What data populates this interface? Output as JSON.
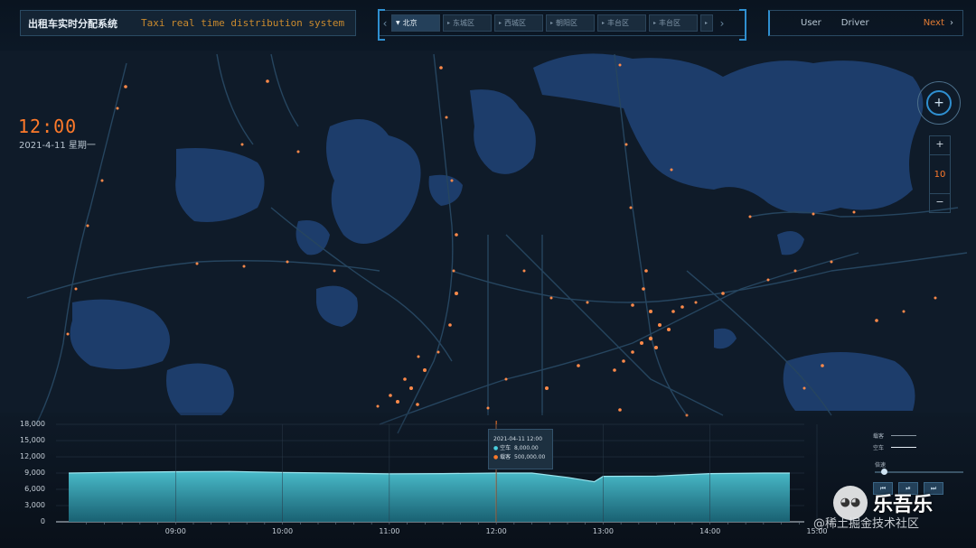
{
  "header": {
    "title_cn": "出租车实时分配系统",
    "title_en": "Taxi real time distribution system",
    "tabs": [
      {
        "label": "北京",
        "active": true
      },
      {
        "label": "东城区",
        "active": false
      },
      {
        "label": "西城区",
        "active": false
      },
      {
        "label": "朝阳区",
        "active": false
      },
      {
        "label": "丰台区",
        "active": false
      },
      {
        "label": "丰台区",
        "active": false
      }
    ],
    "tabs_prev_icon": "‹",
    "tabs_next_icon": "›",
    "user_label": "User",
    "driver_label": "Driver",
    "next_label": "Next",
    "next_icon": "›"
  },
  "clock": {
    "time": "12:00",
    "date": "2021-4-11 星期一"
  },
  "map_controls": {
    "compass_icon": "+",
    "zoom_in": "+",
    "zoom_level": "10",
    "zoom_out": "−"
  },
  "chart_data": {
    "type": "area",
    "x": [
      "08:00",
      "08:30",
      "09:00",
      "09:30",
      "10:00",
      "10:30",
      "11:00",
      "11:30",
      "12:00",
      "12:20",
      "12:40",
      "12:55",
      "13:00",
      "13:30",
      "14:00",
      "14:30",
      "15:00"
    ],
    "xticks": [
      "09:00",
      "10:00",
      "11:00",
      "12:00",
      "13:00",
      "14:00",
      "15:00"
    ],
    "yticks": [
      "0",
      "3,000",
      "6,000",
      "9,000",
      "12,000",
      "15,000",
      "18,000"
    ],
    "ylim": [
      0,
      18000
    ],
    "series": [
      {
        "name": "空车",
        "values": [
          9000,
          9150,
          9250,
          9300,
          9100,
          9000,
          8850,
          8900,
          9000,
          9000,
          8200,
          7400,
          8400,
          8450,
          8900,
          9000,
          9000
        ]
      }
    ],
    "cursor_x": "12:00",
    "colors": {
      "area": "#3fb8c8",
      "line": "#9be6f0",
      "cursor": "#ff7a2a"
    }
  },
  "tooltip": {
    "time": "2021-04-11 12:00",
    "row1_label": "空车",
    "row1_value": "8,000.00",
    "row2_label": "载客",
    "row2_value": "500,000.00"
  },
  "legend": {
    "item1": "载客",
    "item2": "空车"
  },
  "speed": {
    "label": "倍速"
  },
  "playback": {
    "prev_icon": "⏮",
    "play_icon": "⏯",
    "next_icon": "⏭"
  },
  "watermark": {
    "icon": "WeChat",
    "name": "乐吾乐",
    "sub": "@稀土掘金技术社区"
  }
}
